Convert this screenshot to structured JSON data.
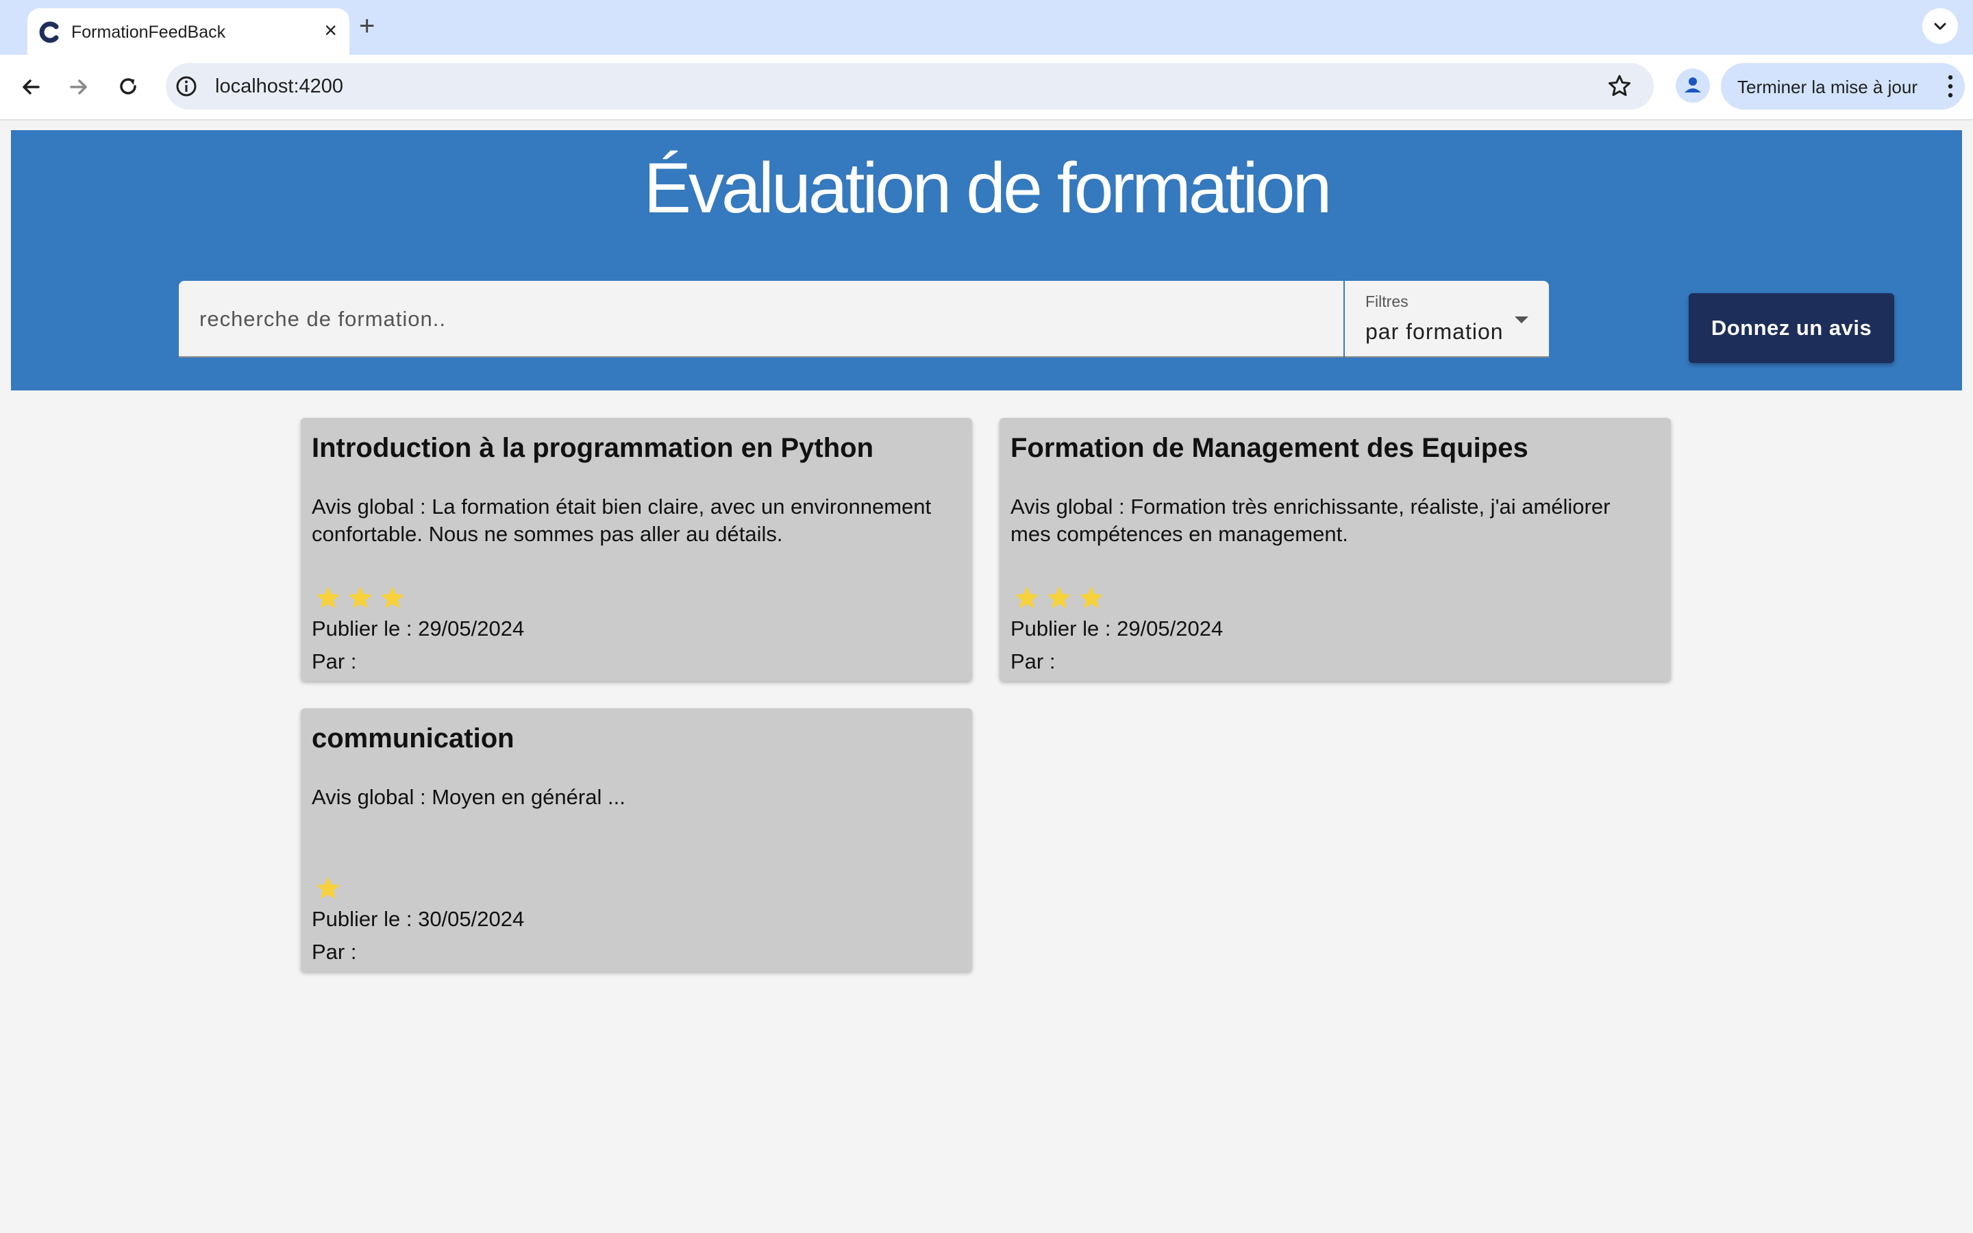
{
  "browser": {
    "tab_title": "FormationFeedBack",
    "url": "localhost:4200",
    "update_label": "Terminer la mise à jour"
  },
  "page": {
    "title": "Évaluation de formation",
    "search_placeholder": "recherche de formation..",
    "filter": {
      "label": "Filtres",
      "value": "par formation"
    },
    "review_button": "Donnez un avis"
  },
  "cards": [
    {
      "title": "Introduction à la programmation en Python",
      "avis": "Avis global : La formation était bien claire, avec un environnement confortable. Nous ne sommes pas aller au détails.",
      "stars": 3,
      "date": "Publier le : 29/05/2024",
      "author": "Par :"
    },
    {
      "title": "Formation de Management des Equipes",
      "avis": "Avis global : Formation très enrichissante, réaliste, j'ai améliorer mes compétences en management.",
      "stars": 3,
      "date": "Publier le : 29/05/2024",
      "author": "Par :"
    },
    {
      "title": "communication",
      "avis": "Avis global : Moyen en général ...",
      "stars": 1,
      "date": "Publier le : 30/05/2024",
      "author": "Par :"
    }
  ],
  "colors": {
    "header": "#3579be",
    "button": "#1e2e5a",
    "card": "#cbcbcb",
    "star": "#f7d23e"
  }
}
